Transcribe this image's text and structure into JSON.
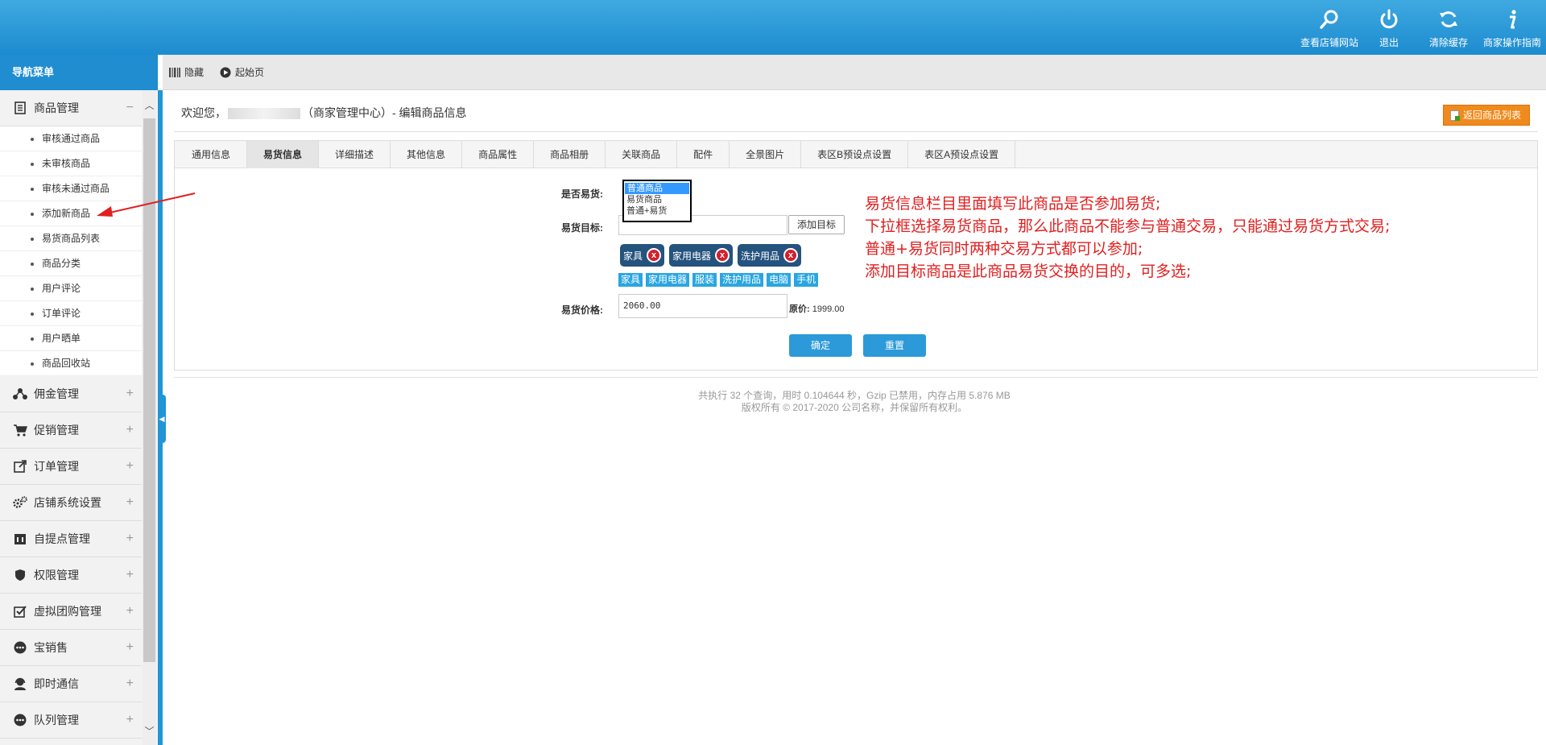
{
  "header": {
    "actions": [
      {
        "label": "查看店铺网站",
        "icon": "search-icon"
      },
      {
        "label": "退出",
        "icon": "power-icon"
      },
      {
        "label": "清除缓存",
        "icon": "refresh-icon"
      },
      {
        "label": "商家操作指南",
        "icon": "info-icon"
      }
    ]
  },
  "sidebar": {
    "title": "导航菜单",
    "groups": [
      {
        "label": "商品管理",
        "toggle": "−",
        "icon": "document-icon",
        "items": [
          "审核通过商品",
          "未审核商品",
          "审核未通过商品",
          "添加新商品",
          "易货商品列表",
          "商品分类",
          "用户评论",
          "订单评论",
          "用户晒单",
          "商品回收站"
        ]
      },
      {
        "label": "佣金管理",
        "toggle": "+",
        "icon": "share-icon"
      },
      {
        "label": "促销管理",
        "toggle": "+",
        "icon": "cart-icon"
      },
      {
        "label": "订单管理",
        "toggle": "+",
        "icon": "export-icon"
      },
      {
        "label": "店铺系统设置",
        "toggle": "+",
        "icon": "gears-icon"
      },
      {
        "label": "自提点管理",
        "toggle": "+",
        "icon": "calendar-icon"
      },
      {
        "label": "权限管理",
        "toggle": "+",
        "icon": "shield-icon"
      },
      {
        "label": "虚拟团购管理",
        "toggle": "+",
        "icon": "checkbox-icon"
      },
      {
        "label": "宝销售",
        "toggle": "+",
        "icon": "dots-icon"
      },
      {
        "label": "即时通信",
        "toggle": "+",
        "icon": "headset-icon"
      },
      {
        "label": "队列管理",
        "toggle": "+",
        "icon": "dots-icon"
      }
    ]
  },
  "toolbar": {
    "hide_label": "隐藏",
    "home_label": "起始页"
  },
  "page": {
    "welcome_prefix": "欢迎您，",
    "welcome_suffix": "（商家管理中心）- 编辑商品信息",
    "back_button": "返回商品列表"
  },
  "tabs": [
    "通用信息",
    "易货信息",
    "详细描述",
    "其他信息",
    "商品属性",
    "商品相册",
    "关联商品",
    "配件",
    "全景图片",
    "表区B预设点设置",
    "表区A预设点设置"
  ],
  "active_tab": "易货信息",
  "form": {
    "barter_label": "是否易货:",
    "barter_options": [
      "普通商品",
      "易货商品",
      "普通+易货"
    ],
    "barter_selected": "普通商品",
    "target_label": "易货目标:",
    "add_target_button": "添加目标",
    "selected_targets": [
      "家具",
      "家用电器",
      "洗护用品"
    ],
    "remove_symbol": "x",
    "target_options": [
      "家具",
      "家用电器",
      "服装",
      "洗护用品",
      "电脑",
      "手机"
    ],
    "price_label": "易货价格:",
    "price_value": "2060.00",
    "original_price_label": "原价:",
    "original_price_value": "1999.00",
    "confirm_button": "确定",
    "reset_button": "重置"
  },
  "annotation": [
    "易货信息栏目里面填写此商品是否参加易货;",
    "下拉框选择易货商品，那么此商品不能参与普通交易，只能通过易货方式交易;",
    "普通+易货同时两种交易方式都可以参加;",
    "添加目标商品是此商品易货交换的目的，可多选;"
  ],
  "footer": {
    "line1": "共执行 32 个查询，用时 0.104644 秒，Gzip 已禁用，内存占用 5.876 MB",
    "line2": "版权所有 © 2017-2020 公司名称，并保留所有权利。"
  },
  "colors": {
    "header_blue": "#1c8bcf",
    "accent_orange": "#f08a1c",
    "chip_navy": "#24537e",
    "annotation_red": "#e02020"
  }
}
